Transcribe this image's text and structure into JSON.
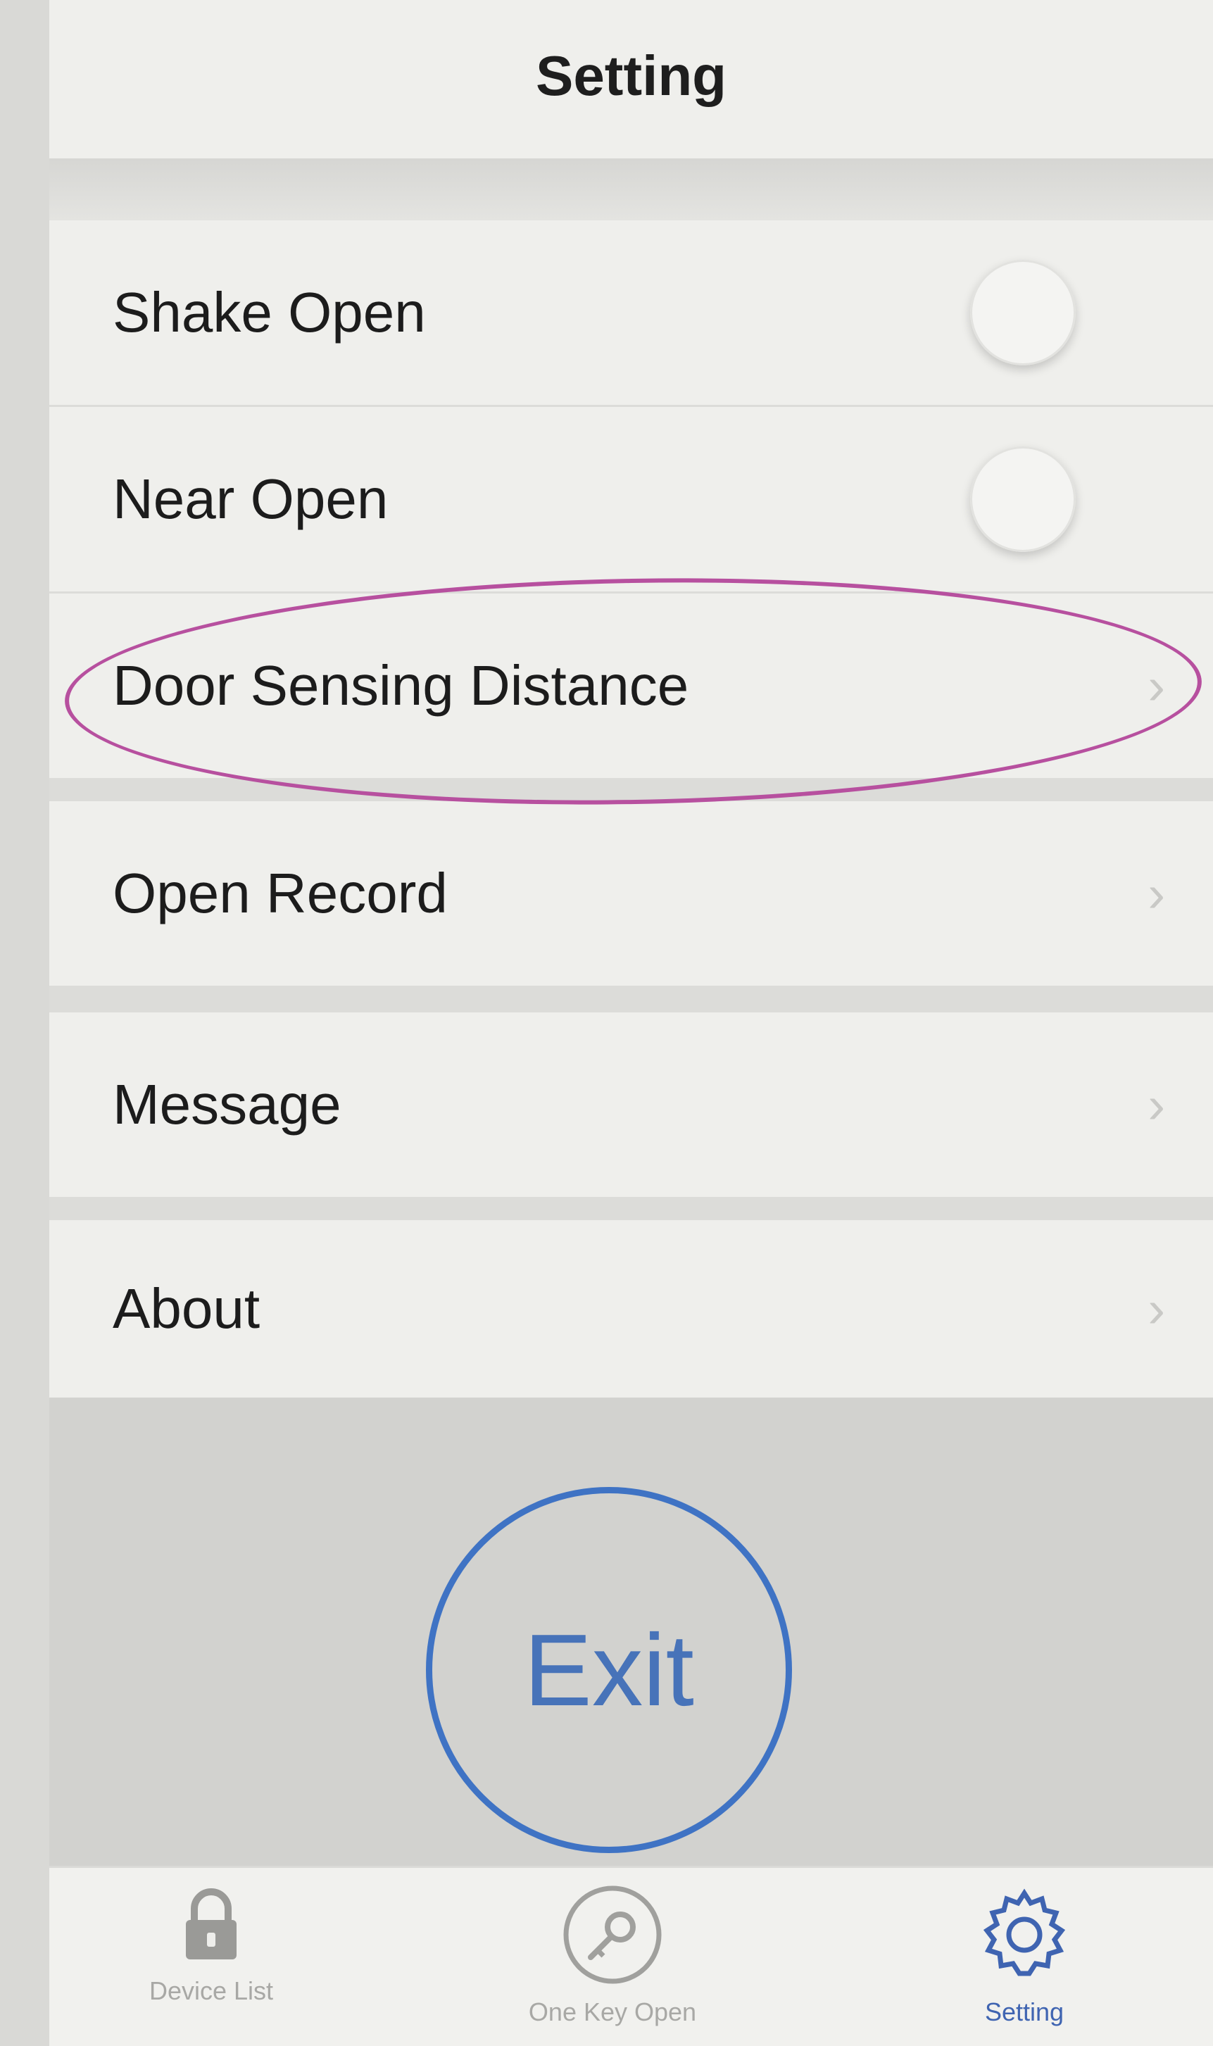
{
  "header": {
    "title": "Setting"
  },
  "settings": {
    "shake_open": {
      "label": "Shake Open",
      "enabled": false
    },
    "near_open": {
      "label": "Near Open",
      "enabled": false
    },
    "door_sensing_distance": {
      "label": "Door Sensing Distance"
    },
    "open_record": {
      "label": "Open Record"
    },
    "message": {
      "label": "Message"
    },
    "about": {
      "label": "About"
    }
  },
  "exit_button": {
    "label": "Exit"
  },
  "tab_bar": {
    "tabs": [
      {
        "label": "Device List",
        "icon": "lock-icon",
        "active": false
      },
      {
        "label": "One Key Open",
        "icon": "key-icon",
        "active": false
      },
      {
        "label": "Setting",
        "icon": "gear-icon",
        "active": true
      }
    ]
  },
  "colors": {
    "accent": "#3f64b1",
    "annotation": "#b7509f",
    "background": "#ecece9"
  }
}
